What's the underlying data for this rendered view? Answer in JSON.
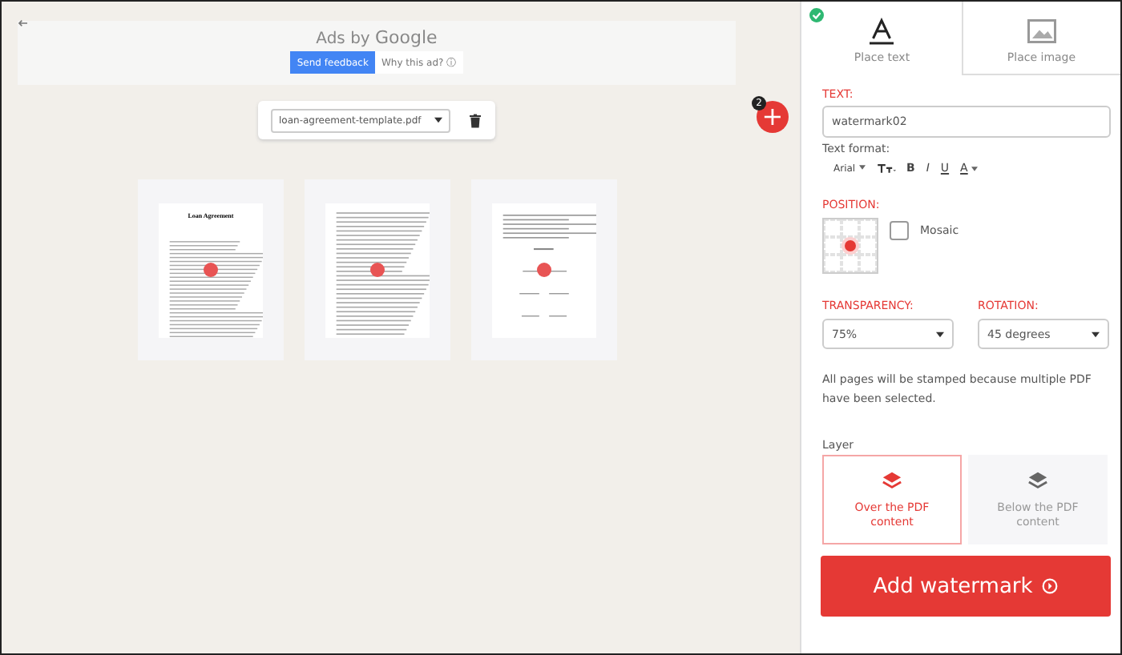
{
  "ad": {
    "label": "Ads by",
    "brand": "Google",
    "feedback_button": "Send feedback",
    "why_button": "Why this ad?",
    "info_glyph": "ⓘ"
  },
  "file_select": {
    "value": "loan-agreement-template.pdf"
  },
  "add_button": {
    "glyph": "+",
    "badge": "2"
  },
  "pages": [
    {
      "kind": "title",
      "title": "Loan Agreement"
    },
    {
      "kind": "text"
    },
    {
      "kind": "signatures"
    }
  ],
  "tabs": [
    {
      "label": "Place text",
      "selected": true
    },
    {
      "label": "Place image",
      "selected": false
    }
  ],
  "text_section": {
    "label": "TEXT:",
    "value": "watermark02",
    "format_label": "Text format:",
    "font": "Arial",
    "bold": "B",
    "italic": "I",
    "underline": "U",
    "color_glyph": "A"
  },
  "position": {
    "label": "POSITION:",
    "cells": [
      {
        "selected": false
      },
      {
        "selected": false
      },
      {
        "selected": false
      },
      {
        "selected": false
      },
      {
        "selected": true
      },
      {
        "selected": false
      },
      {
        "selected": false
      },
      {
        "selected": false
      },
      {
        "selected": false
      }
    ],
    "mosaic": {
      "label": "Mosaic",
      "checked": false
    }
  },
  "transparency": {
    "label": "TRANSPARENCY:",
    "value": "75%"
  },
  "rotation": {
    "label": "ROTATION:",
    "value": "45 degrees"
  },
  "note": "All pages will be stamped because multiple PDF have been selected.",
  "layer": {
    "label": "Layer",
    "options": [
      {
        "label": "Over the PDF content",
        "selected": true
      },
      {
        "label": "Below the PDF content",
        "selected": false
      }
    ]
  },
  "submit_button": "Add watermark"
}
